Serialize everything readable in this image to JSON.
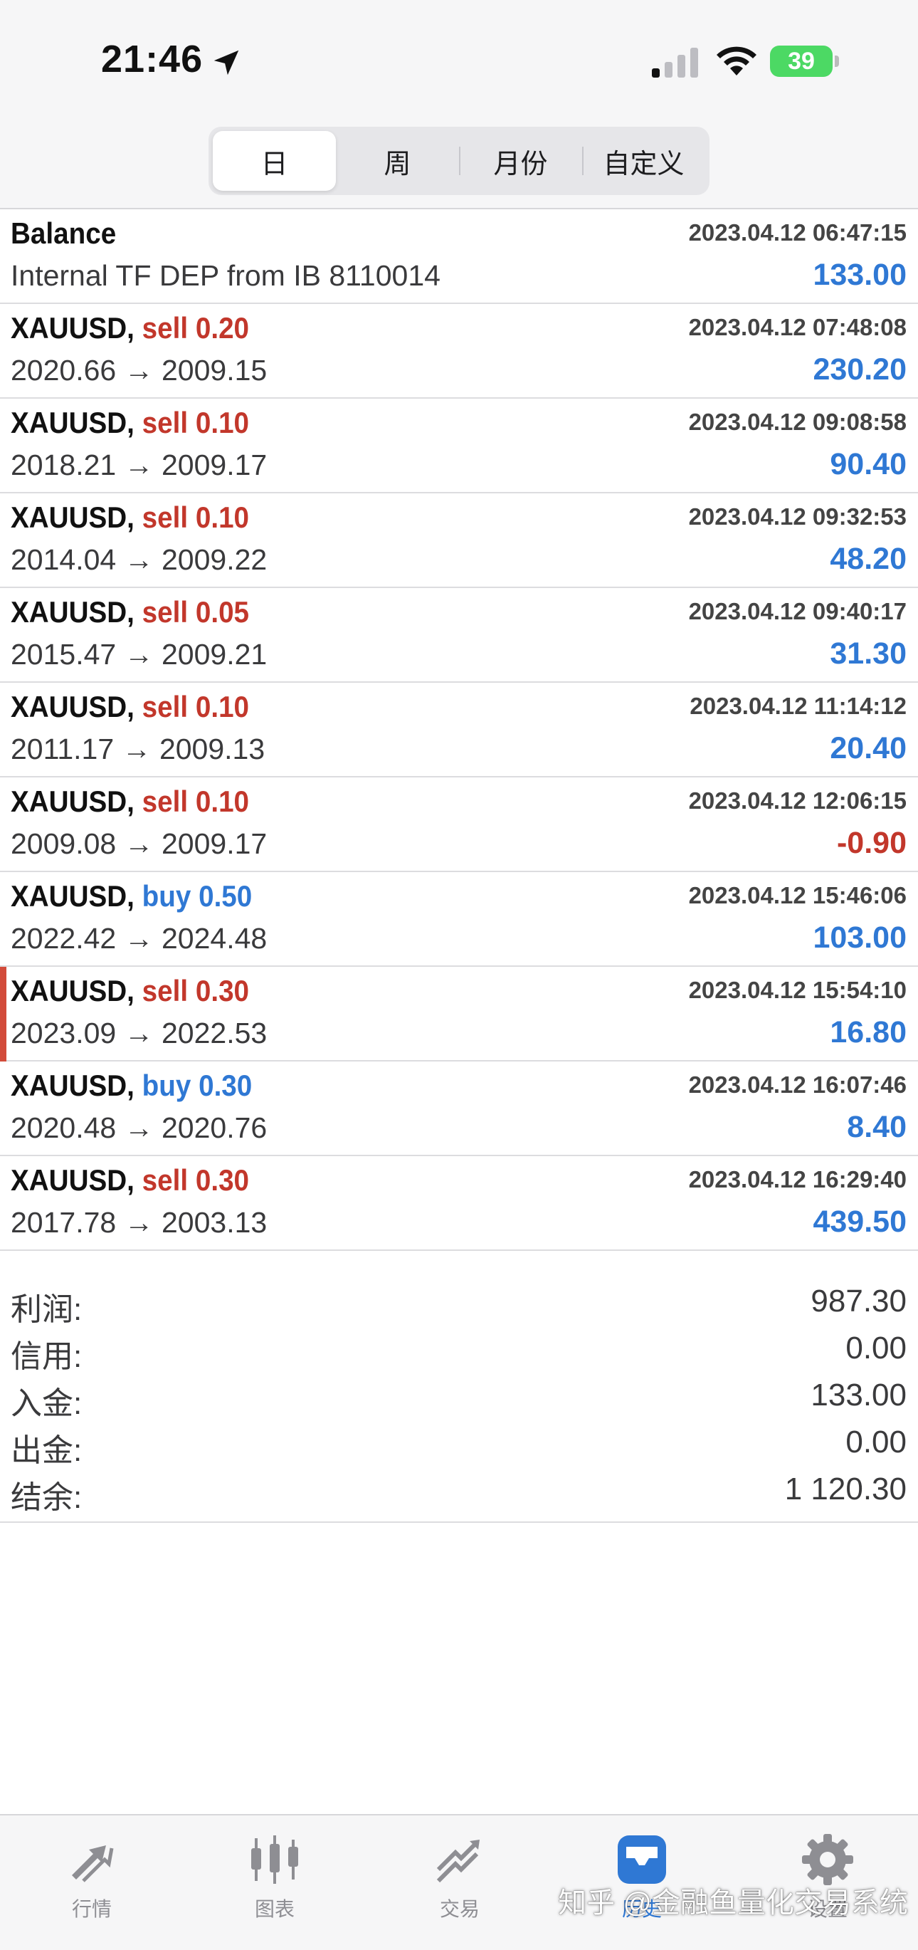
{
  "status_bar": {
    "time": "21:46",
    "battery": "39"
  },
  "period_tabs": [
    {
      "label": "日",
      "active": true
    },
    {
      "label": "周",
      "active": false
    },
    {
      "label": "月份",
      "active": false
    },
    {
      "label": "自定义",
      "active": false
    }
  ],
  "deals": [
    {
      "symbol": "Balance",
      "side": "",
      "volume": "",
      "datetime": "2023.04.12 06:47:15",
      "detail": "Internal TF DEP from IB 8110014",
      "profit": "133.00"
    },
    {
      "symbol": "XAUUSD,",
      "side": "sell",
      "volume": "0.20",
      "datetime": "2023.04.12 07:48:08",
      "detail": "2020.66 → 2009.15",
      "profit": "230.20"
    },
    {
      "symbol": "XAUUSD,",
      "side": "sell",
      "volume": "0.10",
      "datetime": "2023.04.12 09:08:58",
      "detail": "2018.21 → 2009.17",
      "profit": "90.40"
    },
    {
      "symbol": "XAUUSD,",
      "side": "sell",
      "volume": "0.10",
      "datetime": "2023.04.12 09:32:53",
      "detail": "2014.04 → 2009.22",
      "profit": "48.20"
    },
    {
      "symbol": "XAUUSD,",
      "side": "sell",
      "volume": "0.05",
      "datetime": "2023.04.12 09:40:17",
      "detail": "2015.47 → 2009.21",
      "profit": "31.30"
    },
    {
      "symbol": "XAUUSD,",
      "side": "sell",
      "volume": "0.10",
      "datetime": "2023.04.12 11:14:12",
      "detail": "2011.17 → 2009.13",
      "profit": "20.40"
    },
    {
      "symbol": "XAUUSD,",
      "side": "sell",
      "volume": "0.10",
      "datetime": "2023.04.12 12:06:15",
      "detail": "2009.08 → 2009.17",
      "profit": "-0.90"
    },
    {
      "symbol": "XAUUSD,",
      "side": "buy",
      "volume": "0.50",
      "datetime": "2023.04.12 15:46:06",
      "detail": "2022.42 → 2024.48",
      "profit": "103.00"
    },
    {
      "symbol": "XAUUSD,",
      "side": "sell",
      "volume": "0.30",
      "datetime": "2023.04.12 15:54:10",
      "detail": "2023.09 → 2022.53",
      "profit": "16.80"
    },
    {
      "symbol": "XAUUSD,",
      "side": "buy",
      "volume": "0.30",
      "datetime": "2023.04.12 16:07:46",
      "detail": "2020.48 → 2020.76",
      "profit": "8.40"
    },
    {
      "symbol": "XAUUSD,",
      "side": "sell",
      "volume": "0.30",
      "datetime": "2023.04.12 16:29:40",
      "detail": "2017.78 → 2003.13",
      "profit": "439.50"
    }
  ],
  "summary": {
    "profit_label": "利润:",
    "profit_value": "987.30",
    "credit_label": "信用:",
    "credit_value": "0.00",
    "deposit_label": "入金:",
    "deposit_value": "133.00",
    "withdrawal_label": "出金:",
    "withdrawal_value": "0.00",
    "balance_label": "结余:",
    "balance_value": "1 120.30"
  },
  "tab_bar": {
    "quotes": "行情",
    "charts": "图表",
    "trade": "交易",
    "history": "历史",
    "settings": "设置"
  },
  "watermark": "知乎 @金融鱼量化交易系统",
  "colors": {
    "sell": "#c2372b",
    "buy": "#2f78d4",
    "profit_positive": "#2f78d4",
    "profit_negative": "#c2372b"
  }
}
